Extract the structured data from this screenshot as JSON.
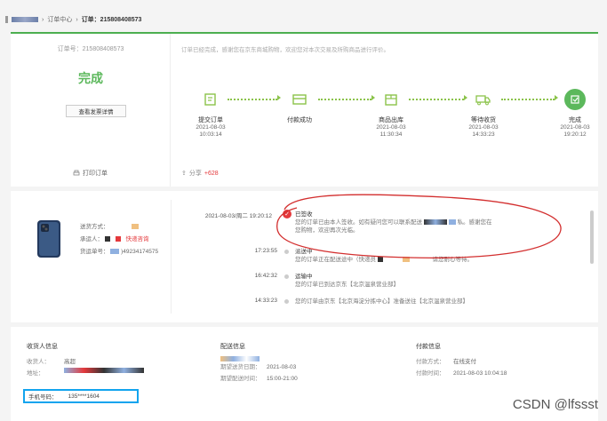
{
  "breadcrumb": {
    "items": [
      "订单中心",
      "订单：215808408573"
    ]
  },
  "order": {
    "number_label": "订单号：215808408573",
    "status": "完成",
    "invoice_button": "查看发票详情",
    "print_label": "打印订单",
    "notice": "订单已经完成，感谢您在京东商城购物，欢迎您对本次交易及所购商品进行评价。",
    "share_label": "分享",
    "share_count": "+628",
    "steps": [
      {
        "label": "提交订单",
        "date": "2021-08-03",
        "time": "10:03:14"
      },
      {
        "label": "付款成功",
        "date": "",
        "time": ""
      },
      {
        "label": "商品出库",
        "date": "2021-08-03",
        "time": "11:30:34"
      },
      {
        "label": "等待收货",
        "date": "2021-08-03",
        "time": "14:33:23"
      },
      {
        "label": "完成",
        "date": "2021-08-03",
        "time": "19:20:12"
      }
    ]
  },
  "shipping": {
    "method_label": "送货方式：",
    "carrier_label": "承运人：",
    "carrier_link": "快递咨询",
    "tracking_label": "货运单号：",
    "tracking_value": ")49234174575"
  },
  "tracking": [
    {
      "time": "2021-08-03/周二  19:20:12",
      "title": "已签收",
      "desc": "您的订单已由本人签收。如有疑问您可以联系配送",
      "desc2": "您购物，欢迎再次光临。",
      "tail": "私。感谢您在"
    },
    {
      "time": "17:23:55",
      "title": "派送中",
      "desc": "您的订单正在配送途中（快递员",
      "tail": "请您耐心等待。"
    },
    {
      "time": "16:42:32",
      "title": "运输中",
      "desc": "您的订单已到达京东【北京温泉营业部】"
    },
    {
      "time": "14:33:23",
      "title": "",
      "desc": "您的订单由京东【北京海淀分拣中心】准备送往【北京温泉营业部】"
    }
  ],
  "receiver": {
    "heading": "收货人信息",
    "name_label": "收货人：",
    "name_value": "高超",
    "address_label": "地址：",
    "phone_label": "手机号码：",
    "phone_value": "135****1604"
  },
  "delivery": {
    "heading": "配送信息",
    "date_label": "期望送货日期：",
    "date_value": "2021-08-03",
    "time_label": "期望配送时间：",
    "time_value": "15:00-21:00"
  },
  "payment": {
    "heading": "付款信息",
    "method_label": "付款方式：",
    "method_value": "在线支付",
    "time_label": "付款时间：",
    "time_value": "2021-08-03 10:04:18"
  },
  "watermark": "CSDN @lfssst",
  "colors": {
    "accent": "#5cb85c",
    "link_red": "#e4393c",
    "highlight_box": "#12a4ee",
    "annotation": "#d32f2f"
  }
}
